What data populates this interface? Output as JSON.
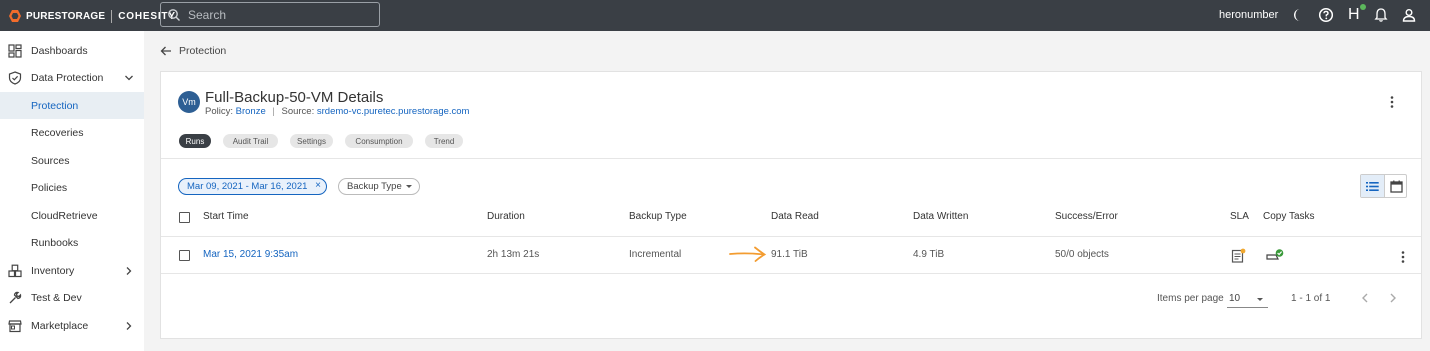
{
  "topbar": {
    "brand_left": "PURESTORAGE",
    "brand_right": "COHESITY",
    "search_placeholder": "Search",
    "username": "heronumber",
    "helios_letter": "H",
    "icons": [
      "moon-icon",
      "help-icon",
      "helios-icon",
      "bell-icon",
      "user-icon"
    ]
  },
  "sidebar": {
    "items": [
      {
        "label": "Dashboards",
        "icon": "dashboard-icon"
      },
      {
        "label": "Data Protection",
        "icon": "shield-icon",
        "expanded": true
      },
      {
        "label": "Protection",
        "active": true
      },
      {
        "label": "Recoveries"
      },
      {
        "label": "Sources"
      },
      {
        "label": "Policies"
      },
      {
        "label": "CloudRetrieve"
      },
      {
        "label": "Runbooks"
      },
      {
        "label": "Inventory",
        "icon": "inventory-icon"
      },
      {
        "label": "Test & Dev",
        "icon": "wrench-icon"
      },
      {
        "label": "Marketplace",
        "icon": "store-icon"
      }
    ]
  },
  "breadcrumb": {
    "label": "Protection"
  },
  "details": {
    "avatar": "Vm",
    "title": "Full-Backup-50-VM Details",
    "policy_label": "Policy:",
    "policy_value": "Bronze",
    "source_label": "Source:",
    "source_value": "srdemo-vc.puretec.purestorage.com",
    "tabs": [
      {
        "label": "Runs",
        "active": true
      },
      {
        "label": "Audit Trail"
      },
      {
        "label": "Settings"
      },
      {
        "label": "Consumption"
      },
      {
        "label": "Trend"
      }
    ]
  },
  "filters": {
    "date_range": "Mar 09, 2021 - Mar 16, 2021",
    "clear": "×",
    "backup_type": "Backup Type"
  },
  "table": {
    "headers": [
      "Start Time",
      "Duration",
      "Backup Type",
      "Data Read",
      "Data Written",
      "Success/Error",
      "SLA",
      "Copy Tasks"
    ],
    "rows": [
      {
        "start_time": "Mar 15, 2021 9:35am",
        "duration": "2h 13m 21s",
        "backup_type": "Incremental",
        "data_read": "91.1 TiB",
        "data_written": "4.9 TiB",
        "success_error": "50/0 objects"
      }
    ]
  },
  "paginator": {
    "items_per_page_label": "Items per page",
    "items_per_page": "10",
    "range": "1 - 1 of 1"
  },
  "colors": {
    "topbar": "#3a3f45",
    "link": "#1565c0",
    "annotation_arrow": "#f39c30",
    "success": "#3a9a3a"
  }
}
